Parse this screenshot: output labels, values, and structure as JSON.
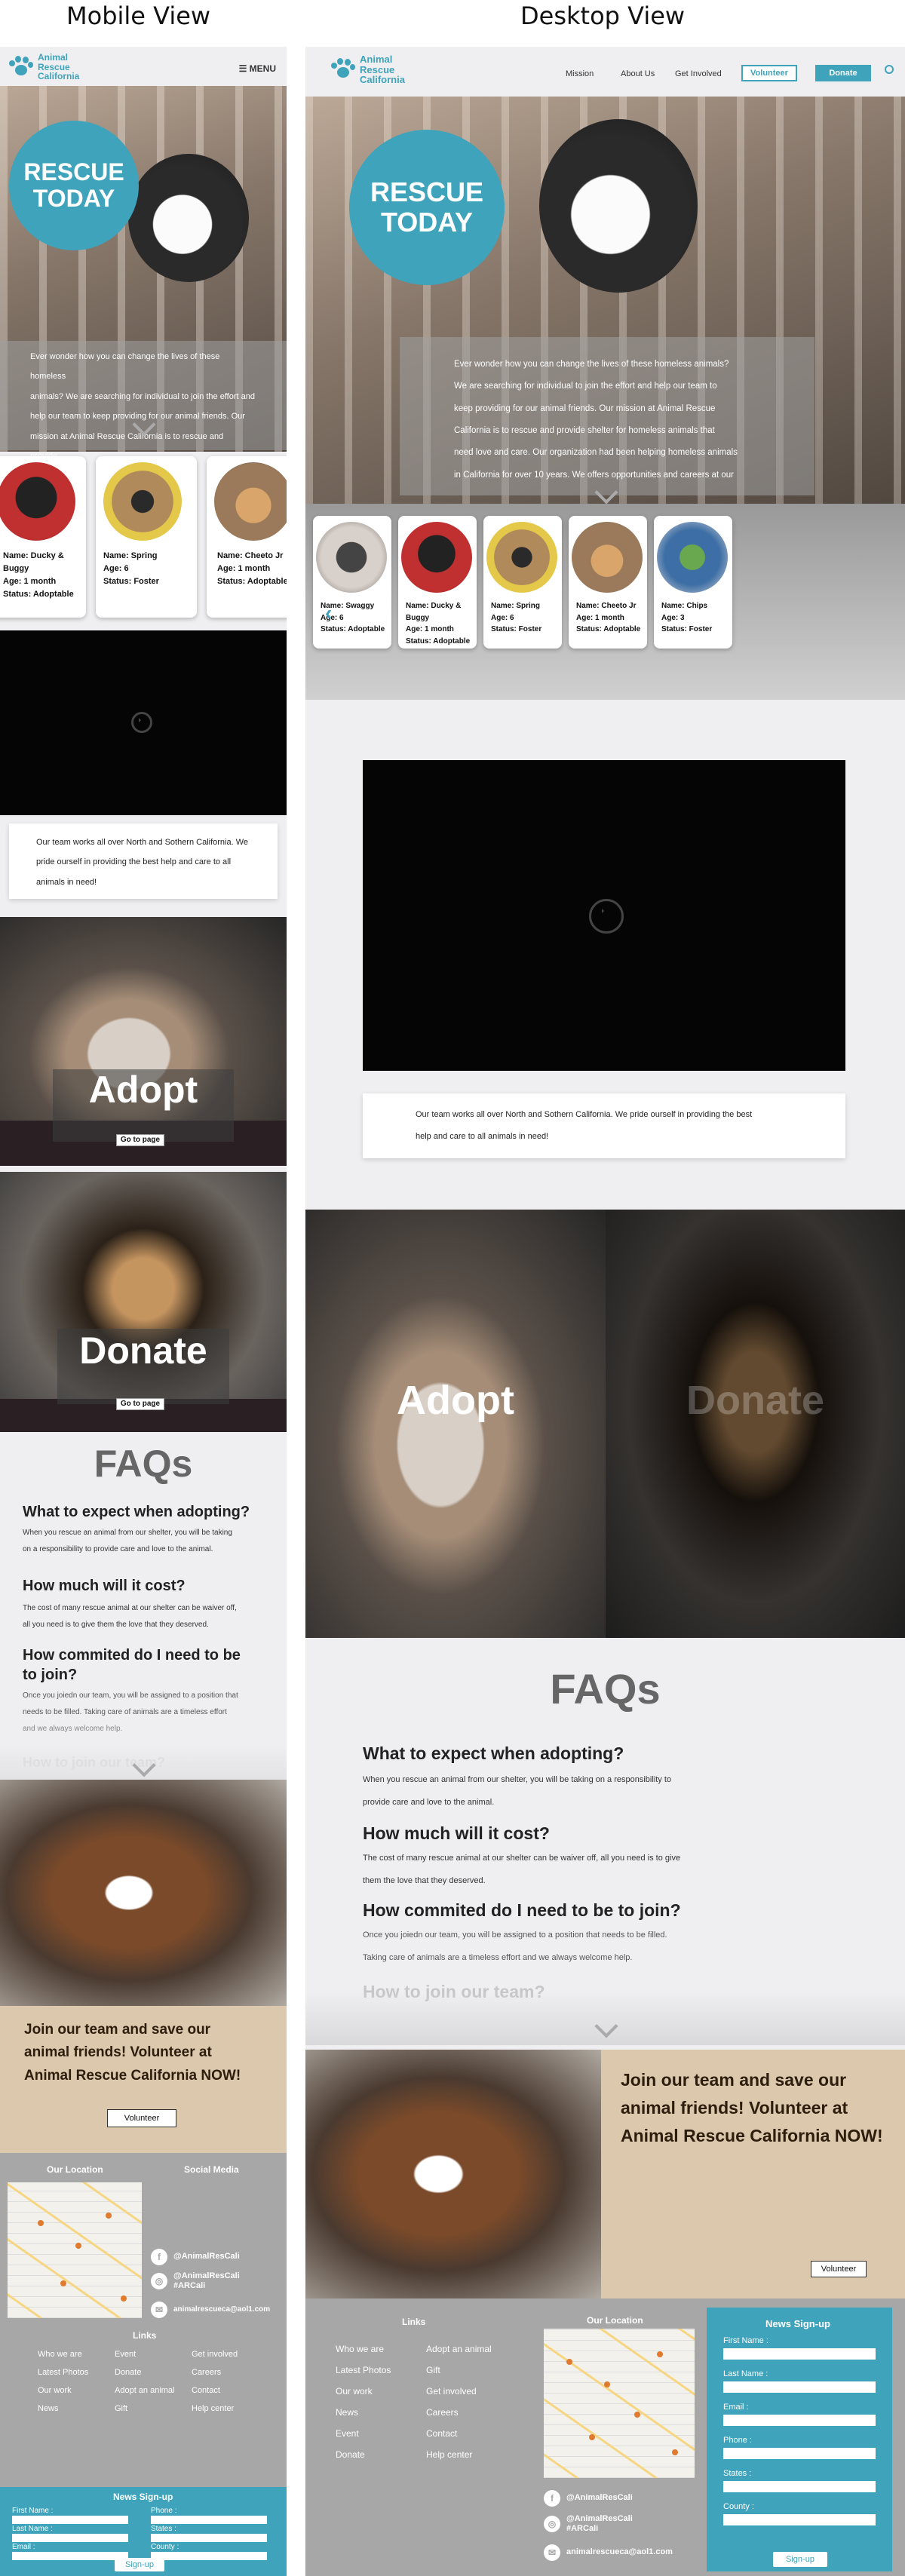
{
  "labels": {
    "mobile": "Mobile View",
    "desktop": "Desktop View"
  },
  "colors": {
    "accent": "#3ea3bb",
    "join_bg": "#dcc8ad",
    "footer_bg": "#a7a7a7"
  },
  "brand": {
    "line1": "Animal",
    "line2": "Rescue",
    "line3": "California"
  },
  "nav": {
    "menu": "MENU",
    "links": [
      "Mission",
      "About Us",
      "Get Involved"
    ],
    "volunteer": "Volunteer",
    "donate": "Donate"
  },
  "hero": {
    "badge_line1": "RESCUE",
    "badge_line2": "TODAY",
    "mobile_lines": [
      "Ever wonder how you can change the lives of these homeless",
      "animals? We are searching for individual to join the effort and",
      "help our team to keep providing for our animal friends. Our",
      "mission at Animal Rescue California is to rescue and provide..."
    ],
    "desktop_lines": [
      "Ever wonder how you can change the lives of these homeless animals?",
      "We are searching for individual to join the effort and help our team to",
      "keep providing for our animal friends. Our mission at Animal Rescue",
      "California is to rescue and provide shelter for homeless animals that",
      "need love and care. Our organization had been helping homeless animals",
      "in California for over 10 years. We offers opportunities and careers at our"
    ]
  },
  "animals": {
    "mobile": [
      {
        "name": "Name:  Ducky & Buggy",
        "age": "Age: 1 month",
        "status": "Status: Adoptable"
      },
      {
        "name": "Name:  Spring",
        "age": "Age: 6",
        "status": "Status: Foster"
      },
      {
        "name": "Name:  Cheeto Jr",
        "age": "Age: 1 month",
        "status": "Status: Adoptable"
      }
    ],
    "desktop": [
      {
        "name": "Name:  Swaggy",
        "age": "Age: 6",
        "status": "Status: Adoptable"
      },
      {
        "name": "Name:  Ducky & Buggy",
        "age": "Age: 1 month",
        "status": "Status: Adoptable"
      },
      {
        "name": "Name:  Spring",
        "age": "Age: 6",
        "status": "Status: Foster"
      },
      {
        "name": "Name:  Cheeto Jr",
        "age": "Age: 1 month",
        "status": "Status: Adoptable"
      },
      {
        "name": "Name:  Chips",
        "age": "Age: 3",
        "status": "Status: Foster"
      }
    ]
  },
  "about": {
    "mobile_lines": [
      "Our team works all over North and Sothern California. We",
      "pride ourself in providing the best help and care to all",
      "animals in need!"
    ],
    "desktop_lines": [
      "Our team works all over North and Sothern California. We pride ourself in providing the best",
      "help and care to all animals in need!"
    ]
  },
  "sections": {
    "adopt": "Adopt",
    "donate": "Donate",
    "go_to_page": "Go to page",
    "faqs": "FAQs"
  },
  "faq": {
    "q1": "What to expect when adopting?",
    "a1_mobile": [
      "When you rescue an animal from our shelter, you will be taking",
      "on a responsibility to provide care and love to the animal."
    ],
    "a1_desktop": [
      "When you rescue an animal from our shelter, you will be taking on a responsibility to",
      "provide care and love to the animal."
    ],
    "q2": "How much will it cost?",
    "a2_mobile": [
      "The cost of many rescue animal at our shelter can be waiver off,",
      "all you need is to give  them the love that they deserved."
    ],
    "a2_desktop": [
      "The cost of many rescue animal at our shelter can be waiver off, all you need is to give",
      "them the love that they deserved."
    ],
    "q3": "How commited do I need to be to join?",
    "q3_mobile_a": "How commited do I need to be",
    "q3_mobile_b": "to join?",
    "a3_mobile": [
      "Once you joiedn our team, you will be assigned to a position that",
      "needs to be filled. Taking care of animals are a timeless effort",
      "and we always welcome help."
    ],
    "a3_desktop": [
      "Once you joiedn our team, you will be assigned to a position that needs to be filled.",
      "Taking care of animals are a timeless effort and we always welcome help."
    ],
    "q4": "How to join our team?"
  },
  "join": {
    "lines": [
      "Join our team and save our",
      "animal friends! Volunteer at",
      "Animal Rescue California NOW!"
    ],
    "button": "Volunteer"
  },
  "footer": {
    "location_title": "Our Location",
    "social_title": "Social Media",
    "links_title": "Links",
    "links_col1": [
      "Who we are",
      "Latest Photos",
      "Our work",
      "News",
      "Event",
      "Donate"
    ],
    "links_col2": [
      "Adopt an animal",
      "Gift",
      "Get involved",
      "Careers",
      "Contact",
      "Help center"
    ],
    "mobile_col1": [
      "Who we are",
      "Latest Photos",
      "Our work",
      "News"
    ],
    "mobile_col2": [
      "Event",
      "Donate",
      "Adopt an animal",
      "Gift"
    ],
    "mobile_col3": [
      "Get involved",
      "Careers",
      "Contact",
      "Help center"
    ],
    "facebook": "@AnimalResCali",
    "instagram_1": "@AnimalResCali",
    "instagram_2": "#ARCali",
    "email": "animalrescueca@aol1.com",
    "social_icons": [
      "facebook-icon",
      "instagram-icon",
      "mail-icon"
    ]
  },
  "signup": {
    "title": "News Sign-up",
    "fields": [
      "First Name :",
      "Last Name :",
      "Email :",
      "Phone :",
      "States :",
      "County :"
    ],
    "button": "Sign-up"
  }
}
